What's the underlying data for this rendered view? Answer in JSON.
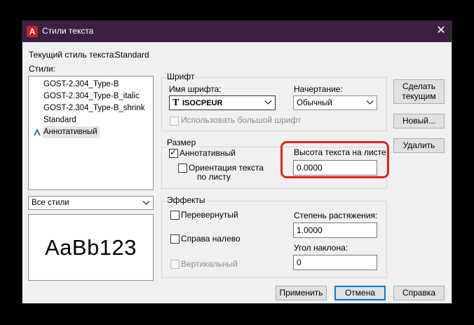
{
  "window": {
    "title": "Стили текста",
    "close_glyph": "✕",
    "app_icon_letter": "A"
  },
  "current_style": {
    "label": "Текущий стиль текста:",
    "value": "Standard"
  },
  "styles": {
    "label": "Стили:",
    "items": [
      {
        "label": "GOST-2.304_Type-B"
      },
      {
        "label": "GOST-2.304_Type-B_italic"
      },
      {
        "label": "GOST-2.304_Type-B_shrink"
      },
      {
        "label": "Standard"
      },
      {
        "label": "Аннотативный"
      }
    ],
    "filter": "Все стили",
    "preview_text": "AaBb123"
  },
  "font": {
    "group_title": "Шрифт",
    "name_label": "Имя шрифта:",
    "name_value": "ISOCPEUR",
    "name_icon": "T",
    "style_label": "Начертание:",
    "style_value": "Обычный",
    "bigfont_label": "Использовать большой шрифт"
  },
  "size": {
    "group_title": "Размер",
    "annotative_label": "Аннотативный",
    "orientation_label_1": "Ориентация текста",
    "orientation_label_2": "по листу",
    "height_label": "Высота текста на листе",
    "height_value": "0.0000"
  },
  "effects": {
    "group_title": "Эффекты",
    "upside_down_label": "Перевернутый",
    "backwards_label": "Справа налево",
    "vertical_label": "Вертикальный",
    "width_label": "Степень растяжения:",
    "width_value": "1.0000",
    "oblique_label": "Угол наклона:",
    "oblique_value": "0"
  },
  "buttons": {
    "set_current_1": "Сделать",
    "set_current_2": "текущим",
    "new": "Новый...",
    "delete": "Удалить",
    "apply": "Применить",
    "cancel": "Отмена",
    "help": "Справка"
  },
  "colors": {
    "titlebar": "#3b2140",
    "highlight": "#e3231f",
    "app_icon": "#c8202a",
    "primary_border": "#0078d7"
  }
}
